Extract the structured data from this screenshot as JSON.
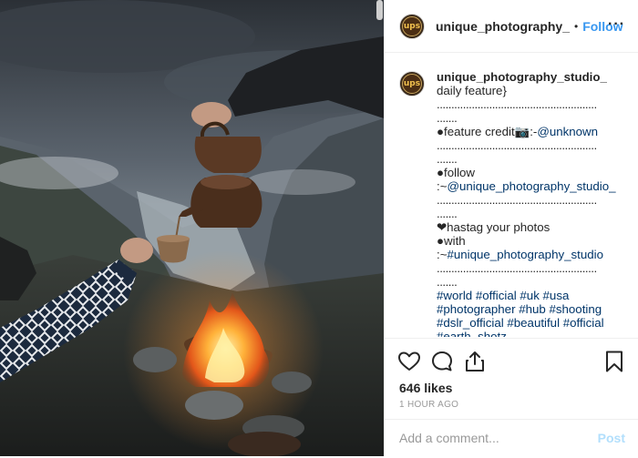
{
  "post": {
    "username": "unique_photography_",
    "separator": "•",
    "follow_label": "Follow",
    "more_label": "···",
    "avatar_text": "ups"
  },
  "caption": {
    "username": "unique_photography_studio_",
    "line1": "daily feature}",
    "dots_a": ".......................................................",
    "dots_b": ".......",
    "credit_prefix": "●feature credit📷:-",
    "credit_link": "@unknown",
    "dots_c": ".......................................................",
    "dots_d": ".......",
    "follow_line": "●follow",
    "follow_link_prefix": ":~",
    "follow_link": "@unique_photography_studio_",
    "dots_e": ".......................................................",
    "dots_f": ".......",
    "hashtag_line": "❤hastag your photos",
    "with_line": "●with",
    "with_prefix": ":~",
    "with_link": "#unique_photography_studio",
    "dots_g": ".......................................................",
    "dots_h": ".......",
    "tags_1": "#world #official #uk #usa",
    "tags_2": "#photographer #hub #shooting",
    "tags_3": "#dslr_official #beautiful #official",
    "tags_4": "#earth_shotz"
  },
  "actions": {
    "likes": "646 likes",
    "time": "1 HOUR AGO",
    "comment_placeholder": "Add a comment...",
    "post_label": "Post"
  },
  "icons": {
    "like": "heart-icon",
    "comment": "comment-icon",
    "share": "share-icon",
    "save": "bookmark-icon"
  },
  "colors": {
    "link": "#003569",
    "follow": "#3897f0",
    "post_disabled": "#b2dffc"
  }
}
